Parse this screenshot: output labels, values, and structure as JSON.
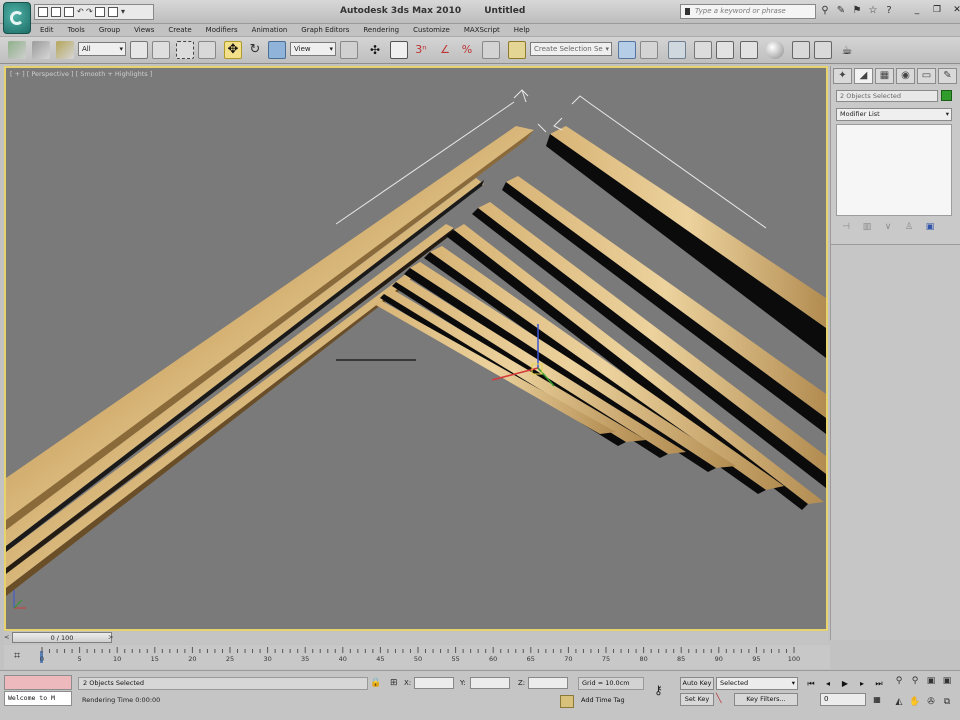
{
  "titlebar": {
    "app_name": "Autodesk 3ds Max 2010",
    "doc_name": "Untitled",
    "search_placeholder": "Type a keyword or phrase"
  },
  "menu": [
    "Edit",
    "Tools",
    "Group",
    "Views",
    "Create",
    "Modifiers",
    "Animation",
    "Graph Editors",
    "Rendering",
    "Customize",
    "MAXScript",
    "Help"
  ],
  "toolbar": {
    "selection_filter": "All",
    "reference_coord": "View",
    "named_selection_placeholder": "Create Selection Se"
  },
  "viewport": {
    "label": "[ + ] [ Perspective ] [ Smooth + Highlights ]"
  },
  "command_panel": {
    "object_name": "2 Objects Selected",
    "modifier_list": "Modifier List",
    "object_color": "#2f9c2c"
  },
  "time_slider": {
    "position": "0 / 100",
    "left_arrow": "<",
    "right_arrow": ">"
  },
  "trackbar": {
    "ticks": [
      "0",
      "5",
      "10",
      "15",
      "20",
      "25",
      "30",
      "35",
      "40",
      "45",
      "50",
      "55",
      "60",
      "65",
      "70",
      "75",
      "80",
      "85",
      "90",
      "95",
      "100"
    ]
  },
  "status": {
    "maxscript_listener": "Welcome to M",
    "selection_status": "2 Objects Selected",
    "rendering_time": "Rendering Time  0:00:00",
    "x_label": "X:",
    "y_label": "Y:",
    "z_label": "Z:",
    "grid": "Grid = 10.0cm",
    "add_time_tag": "Add Time Tag",
    "auto_key": "Auto Key",
    "set_key": "Set Key",
    "key_mode": "Selected",
    "key_filters": "Key Filters...",
    "current_frame": "0"
  },
  "colors": {
    "viewport_border": "#e7d36e",
    "viewport_bg": "#7a7a7a",
    "wood_light": "#dcb97a",
    "wood_dark": "#a8834a"
  }
}
